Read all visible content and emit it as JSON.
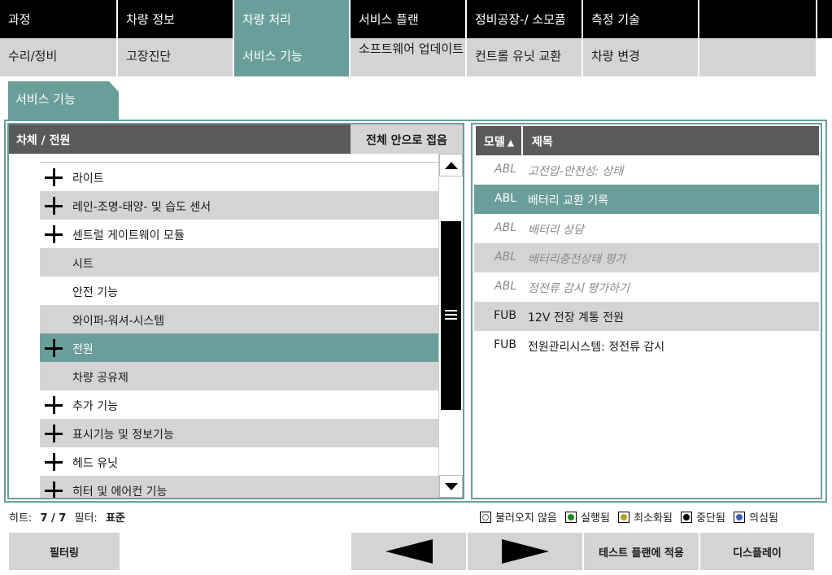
{
  "top_tabs": [
    {
      "label": "과정",
      "active": false
    },
    {
      "label": "차량 정보",
      "active": false
    },
    {
      "label": "차량 처리",
      "active": true
    },
    {
      "label": "서비스 플랜",
      "active": false
    },
    {
      "label": "정비공장-/ 소모품",
      "active": false
    },
    {
      "label": "측정 기술",
      "active": false
    },
    {
      "label": "",
      "active": false
    }
  ],
  "sub_tabs": [
    {
      "label": "수리/정비",
      "active": false
    },
    {
      "label": "고장진단",
      "active": false
    },
    {
      "label": "서비스 기능",
      "active": true
    },
    {
      "label": "소프트웨어 업데이트",
      "active": false
    },
    {
      "label": "컨트롤 유닛 교환",
      "active": false
    },
    {
      "label": "차량 변경",
      "active": false
    },
    {
      "label": "",
      "active": false
    }
  ],
  "section_tab": "서비스 기능",
  "tree": {
    "header_title": "차체 / 전원",
    "collapse_all_label": "전체 안으로 접음",
    "items": [
      {
        "label": "라이트",
        "expandable": true,
        "style": "white"
      },
      {
        "label": "레인-조명-태양- 및 습도 센서",
        "expandable": true,
        "style": "gray"
      },
      {
        "label": "센트럴 게이트웨이 모듈",
        "expandable": true,
        "style": "white"
      },
      {
        "label": "시트",
        "expandable": false,
        "style": "gray"
      },
      {
        "label": "안전 기능",
        "expandable": false,
        "style": "white"
      },
      {
        "label": "와이퍼-워셔-시스템",
        "expandable": false,
        "style": "gray"
      },
      {
        "label": "전원",
        "expandable": true,
        "style": "selected"
      },
      {
        "label": "차량 공유제",
        "expandable": false,
        "style": "gray"
      },
      {
        "label": "추가 기능",
        "expandable": true,
        "style": "white"
      },
      {
        "label": "표시기능 및 정보기능",
        "expandable": true,
        "style": "gray"
      },
      {
        "label": "헤드 유닛",
        "expandable": true,
        "style": "white"
      },
      {
        "label": "히터 및 에어컨 기능",
        "expandable": true,
        "style": "gray"
      }
    ]
  },
  "table": {
    "col_model": "모델",
    "sort_indicator": "▲",
    "col_title": "제목",
    "rows": [
      {
        "model": "ABL",
        "title": "고전압-안전성: 상태",
        "style": "white",
        "dim": true
      },
      {
        "model": "ABL",
        "title": "배터리 교환 기록",
        "style": "selected",
        "dim": false
      },
      {
        "model": "ABL",
        "title": "배터리 상담",
        "style": "white",
        "dim": true
      },
      {
        "model": "ABL",
        "title": "배터리충전상태 평가",
        "style": "gray",
        "dim": true
      },
      {
        "model": "ABL",
        "title": "정전류 감시 평가하기",
        "style": "white",
        "dim": true
      },
      {
        "model": "FUB",
        "title": "12V 전장 계통 전원",
        "style": "gray",
        "dim": false
      },
      {
        "model": "FUB",
        "title": "전원관리시스템: 정전류 감시",
        "style": "white",
        "dim": false
      }
    ]
  },
  "status": {
    "hits_label": "히트:",
    "hits_value": "7 / 7",
    "filter_label": "필터:",
    "filter_value": "표준"
  },
  "legend": [
    {
      "label": "불러오지 않음",
      "color": "#ffffff",
      "icon": "empty-circle-icon"
    },
    {
      "label": "실행됨",
      "color": "#1e8a1e",
      "icon": "green-dot-icon"
    },
    {
      "label": "최소화됨",
      "color": "#b8a020",
      "icon": "yellow-dot-icon"
    },
    {
      "label": "중단됨",
      "color": "#000000",
      "icon": "black-dot-icon"
    },
    {
      "label": "의심됨",
      "color": "#3a5ec8",
      "icon": "blue-dot-icon"
    }
  ],
  "buttons": {
    "filter": "필터링",
    "back_icon": "left-arrow-icon",
    "forward_icon": "right-arrow-icon",
    "apply_test_plan": "테스트 플랜에 적용",
    "display": "디스플레이"
  },
  "colors": {
    "accent": "#6a9e9b",
    "header_dark": "#5a5a5a",
    "row_gray": "#d4d4d4"
  }
}
